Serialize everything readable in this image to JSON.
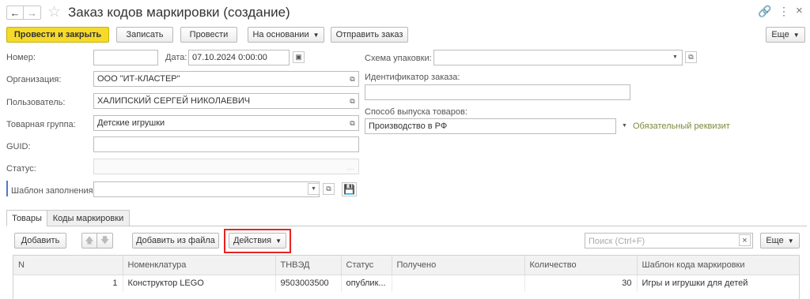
{
  "window": {
    "title": "Заказ кодов маркировки (создание)"
  },
  "toolbar": {
    "post_close": "Провести и закрыть",
    "save": "Записать",
    "post": "Провести",
    "based_on": "На основании",
    "send_order": "Отправить заказ",
    "more": "Еще"
  },
  "form": {
    "number_label": "Номер:",
    "number_value": "",
    "date_label": "Дата:",
    "date_value": "07.10.2024  0:00:00",
    "org_label": "Организация:",
    "org_value": "ООО \"ИТ-КЛАСТЕР\"",
    "user_label": "Пользователь:",
    "user_value": "ХАЛИПСКИЙ СЕРГЕЙ НИКОЛАЕВИЧ",
    "product_group_label": "Товарная группа:",
    "product_group_value": "Детские игрушки",
    "guid_label": "GUID:",
    "guid_value": "",
    "status_label": "Статус:",
    "status_value": "",
    "template_label": "Шаблон заполнения:",
    "template_value": "",
    "packaging_label": "Схема упаковки:",
    "packaging_value": "",
    "order_id_label": "Идентификатор заказа:",
    "order_id_value": "",
    "release_method_label": "Способ выпуска товаров:",
    "release_method_value": "Производство в РФ",
    "required_hint": "Обязательный реквизит"
  },
  "tabs": [
    {
      "label": "Товары"
    },
    {
      "label": "Коды маркировки"
    }
  ],
  "table_toolbar": {
    "add": "Добавить",
    "add_from_file": "Добавить из файла",
    "actions": "Действия",
    "search_placeholder": "Поиск (Ctrl+F)",
    "more": "Еще"
  },
  "table": {
    "headers": [
      "N",
      "Номенклатура",
      "ТНВЭД",
      "Статус",
      "Получено",
      "Количество",
      "Шаблон кода маркировки"
    ],
    "rows": [
      [
        "1",
        "Конструктор LEGO",
        "9503003500",
        "опублик...",
        "",
        "30",
        "Игры и игрушки для детей"
      ]
    ]
  },
  "colors": {
    "primary_button": "#f5da2a",
    "highlight": "#e8231f",
    "hint": "#7a8a3a"
  }
}
